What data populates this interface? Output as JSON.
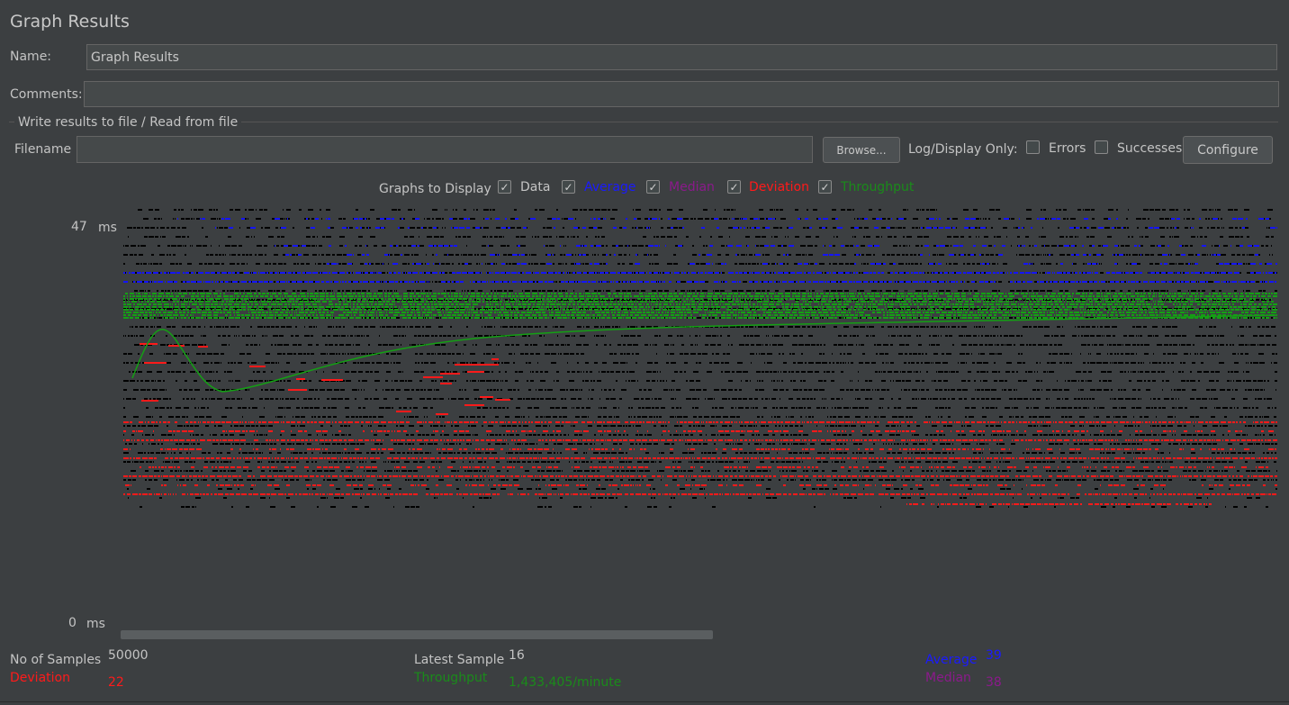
{
  "window": {
    "title": "Graph Results"
  },
  "form": {
    "name_label": "Name:",
    "name_value": "Graph Results",
    "comments_label": "Comments:",
    "comments_value": "",
    "file_group_label": "Write results to file / Read from file",
    "filename_label": "Filename",
    "filename_value": "",
    "browse_label": "Browse...",
    "log_display_label": "Log/Display Only:",
    "errors_label": "Errors",
    "errors_checked": false,
    "successes_label": "Successes",
    "successes_checked": false,
    "configure_label": "Configure"
  },
  "graphs_to_display": {
    "label": "Graphs to Display",
    "check_mark": "✓",
    "options": [
      {
        "label": "Data",
        "checked": true,
        "color": "#c8c8c8"
      },
      {
        "label": "Average",
        "checked": true,
        "color": "#1a1aff"
      },
      {
        "label": "Median",
        "checked": true,
        "color": "#8b1a8b"
      },
      {
        "label": "Deviation",
        "checked": true,
        "color": "#ff1a1a"
      },
      {
        "label": "Throughput",
        "checked": true,
        "color": "#1a8b1a"
      }
    ]
  },
  "graph": {
    "y_max": "47",
    "y_min": "0",
    "y_unit": "ms",
    "colors": {
      "data": "#000000",
      "average": "#1414ff",
      "median": "#8a2a8a",
      "deviation": "#ff1a1a",
      "throughput": "#14a014"
    }
  },
  "stats": {
    "samples_label": "No of Samples",
    "samples_value": "50000",
    "latest_label": "Latest Sample",
    "latest_value": "16",
    "average_label": "Average",
    "average_value": "39",
    "deviation_label": "Deviation",
    "deviation_value": "22",
    "throughput_label": "Throughput",
    "throughput_value": "1,433,405/minute",
    "median_label": "Median",
    "median_value": "38"
  }
}
